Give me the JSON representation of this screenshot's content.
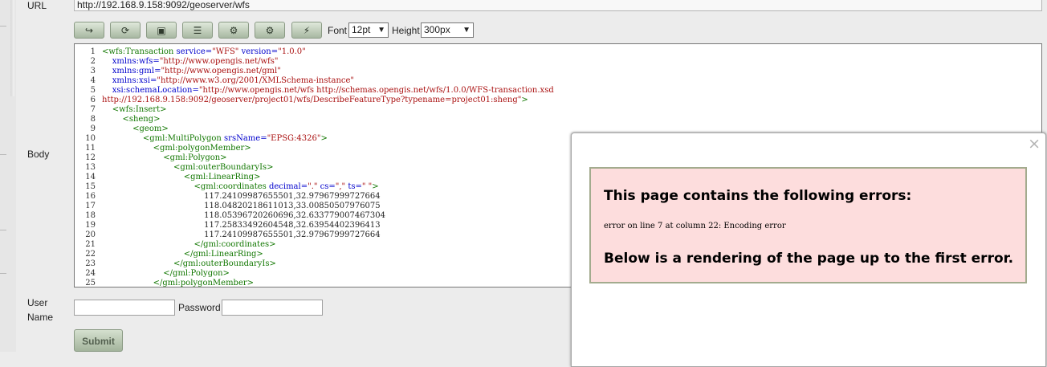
{
  "form": {
    "url_label": "URL",
    "url_value": "http://192.168.9.158:9092/geoserver/wfs",
    "body_label": "Body",
    "user_label": "User Name",
    "password_label": "Password",
    "submit_label": "Submit"
  },
  "toolbar": {
    "buttons": [
      {
        "name": "wrap-icon",
        "glyph": "↪"
      },
      {
        "name": "refresh-icon",
        "glyph": "⟳"
      },
      {
        "name": "image-icon",
        "glyph": "▣"
      },
      {
        "name": "align-icon",
        "glyph": "☰"
      },
      {
        "name": "gear-icon",
        "glyph": "⚙"
      },
      {
        "name": "gear-plus-icon",
        "glyph": "⚙"
      },
      {
        "name": "connect-icon",
        "glyph": "⚡"
      }
    ],
    "font_label": "Font",
    "font_value": "12pt",
    "height_label": "Height",
    "height_value": "300px"
  },
  "editor": {
    "lines": [
      {
        "n": "1",
        "i": 0,
        "p": [
          [
            "t",
            "<wfs:Transaction "
          ],
          [
            "a",
            "service="
          ],
          [
            "s",
            "\"WFS\""
          ],
          [
            "a",
            " version="
          ],
          [
            "s",
            "\"1.0.0\""
          ]
        ]
      },
      {
        "n": "2",
        "i": 4,
        "p": [
          [
            "a",
            "xmlns:wfs="
          ],
          [
            "s",
            "\"http://www.opengis.net/wfs\""
          ]
        ]
      },
      {
        "n": "3",
        "i": 4,
        "p": [
          [
            "a",
            "xmlns:gml="
          ],
          [
            "s",
            "\"http://www.opengis.net/gml\""
          ]
        ]
      },
      {
        "n": "4",
        "i": 4,
        "p": [
          [
            "a",
            "xmlns:xsi="
          ],
          [
            "s",
            "\"http://www.w3.org/2001/XMLSchema-instance\""
          ]
        ]
      },
      {
        "n": "5",
        "i": 4,
        "p": [
          [
            "a",
            "xsi:schemaLocation="
          ],
          [
            "s",
            "\"http://www.opengis.net/wfs http://schemas.opengis.net/wfs/1.0.0/WFS-transaction.xsd"
          ]
        ]
      },
      {
        "n": "6",
        "i": 0,
        "p": [
          [
            "s",
            "http://192.168.9.158:9092/geoserver/project01/wfs/DescribeFeatureType?typename=project01:sheng\""
          ],
          [
            "t",
            ">"
          ]
        ]
      },
      {
        "n": "7",
        "i": 4,
        "p": [
          [
            "t",
            "<wfs:Insert>"
          ]
        ]
      },
      {
        "n": "8",
        "i": 8,
        "p": [
          [
            "t",
            "<sheng>"
          ]
        ]
      },
      {
        "n": "9",
        "i": 12,
        "p": [
          [
            "t",
            "<geom>"
          ]
        ]
      },
      {
        "n": "10",
        "i": 16,
        "p": [
          [
            "t",
            "<gml:MultiPolygon "
          ],
          [
            "a",
            "srsName="
          ],
          [
            "s",
            "\"EPSG:4326\""
          ],
          [
            "t",
            ">"
          ]
        ]
      },
      {
        "n": "11",
        "i": 20,
        "p": [
          [
            "t",
            "<gml:polygonMember>"
          ]
        ]
      },
      {
        "n": "12",
        "i": 24,
        "p": [
          [
            "t",
            "<gml:Polygon>"
          ]
        ]
      },
      {
        "n": "13",
        "i": 28,
        "p": [
          [
            "t",
            "<gml:outerBoundaryIs>"
          ]
        ]
      },
      {
        "n": "14",
        "i": 32,
        "p": [
          [
            "t",
            "<gml:LinearRing>"
          ]
        ]
      },
      {
        "n": "15",
        "i": 36,
        "p": [
          [
            "t",
            "<gml:coordinates "
          ],
          [
            "a",
            "decimal="
          ],
          [
            "s",
            "\".\""
          ],
          [
            "a",
            " cs="
          ],
          [
            "s",
            "\",\""
          ],
          [
            "a",
            " ts="
          ],
          [
            "s",
            "\" \""
          ],
          [
            "t",
            ">"
          ]
        ]
      },
      {
        "n": "16",
        "i": 40,
        "p": [
          [
            "x",
            "117.24109987655501,32.97967999727664"
          ]
        ]
      },
      {
        "n": "17",
        "i": 40,
        "p": [
          [
            "x",
            "118.04820218611013,33.00850507976075"
          ]
        ]
      },
      {
        "n": "18",
        "i": 40,
        "p": [
          [
            "x",
            "118.05396720260696,32.633779007467304"
          ]
        ]
      },
      {
        "n": "19",
        "i": 40,
        "p": [
          [
            "x",
            "117.25833492604548,32.63954402396413"
          ]
        ]
      },
      {
        "n": "20",
        "i": 40,
        "p": [
          [
            "x",
            "117.24109987655501,32.97967999727664"
          ]
        ]
      },
      {
        "n": "21",
        "i": 36,
        "p": [
          [
            "t",
            "</gml:coordinates>"
          ]
        ]
      },
      {
        "n": "22",
        "i": 32,
        "p": [
          [
            "t",
            "</gml:LinearRing>"
          ]
        ]
      },
      {
        "n": "23",
        "i": 28,
        "p": [
          [
            "t",
            "</gml:outerBoundaryIs>"
          ]
        ]
      },
      {
        "n": "24",
        "i": 24,
        "p": [
          [
            "t",
            "</gml:Polygon>"
          ]
        ]
      },
      {
        "n": "25",
        "i": 20,
        "p": [
          [
            "t",
            "</gml:polygonMember>"
          ]
        ]
      }
    ]
  },
  "popup": {
    "close_glyph": "×",
    "heading": "This page contains the following errors:",
    "message": "error on line 7 at column 22: Encoding error",
    "subheading": "Below is a rendering of the page up to the first error."
  },
  "colors": {
    "tag": "#117700",
    "attr": "#0000cc",
    "string": "#aa1111",
    "error_bg": "#fddddd"
  }
}
